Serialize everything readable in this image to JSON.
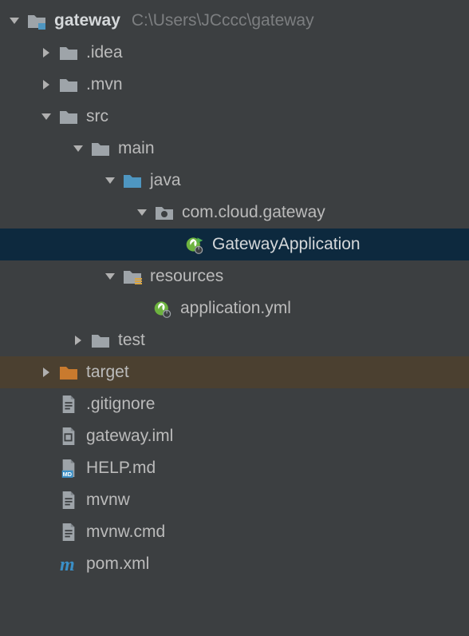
{
  "root": {
    "name": "gateway",
    "path": "C:\\Users\\JCccc\\gateway"
  },
  "nodes": {
    "idea": ".idea",
    "mvn": ".mvn",
    "src": "src",
    "main": "main",
    "java": "java",
    "pkg": "com.cloud.gateway",
    "app": "GatewayApplication",
    "resources": "resources",
    "appyml": "application.yml",
    "test": "test",
    "target": "target",
    "gitignore": ".gitignore",
    "iml": "gateway.iml",
    "help": "HELP.md",
    "mvnw": "mvnw",
    "mvnwcmd": "mvnw.cmd",
    "pom": "pom.xml"
  },
  "colors": {
    "bg": "#3c3f41",
    "selected": "#0d293e",
    "targetRow": "#4b4030",
    "folderGray": "#a0a6ab",
    "folderBlue": "#4e96c1",
    "folderOrange": "#c97a2e",
    "text": "#bbbbbb"
  }
}
